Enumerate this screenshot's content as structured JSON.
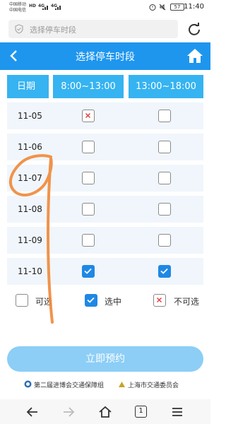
{
  "status": {
    "carrier_1": "中国移动",
    "carrier_2": "中国电信",
    "signal_1": "4G",
    "signal_2": "4G",
    "network_badge": "HD",
    "battery": "57",
    "time": "11:40"
  },
  "browser": {
    "url_placeholder": "选择停车时段",
    "shield_icon": "shield-icon",
    "reload_icon": "reload-icon"
  },
  "header": {
    "title": "选择停车时段",
    "back_icon": "chevron-left-icon",
    "home_icon": "home-icon",
    "color": "#1e96ee"
  },
  "table": {
    "columns": [
      "日期",
      "8:00~13:00",
      "13:00~18:00"
    ],
    "rows": [
      {
        "date": "11-05",
        "slot1": "unavailable",
        "slot2": "available"
      },
      {
        "date": "11-06",
        "slot1": "available",
        "slot2": "available"
      },
      {
        "date": "11-07",
        "slot1": "available",
        "slot2": "available"
      },
      {
        "date": "11-08",
        "slot1": "available",
        "slot2": "available"
      },
      {
        "date": "11-09",
        "slot1": "available",
        "slot2": "available"
      },
      {
        "date": "11-10",
        "slot1": "selected",
        "slot2": "selected"
      }
    ]
  },
  "legend": {
    "available": "可选",
    "selected": "选中",
    "unavailable": "不可选"
  },
  "actions": {
    "book_label": "立即预约"
  },
  "footer": {
    "org_1": "第二届进博会交通保障组",
    "org_2": "上海市交通委员会"
  },
  "nav": {
    "tab_count": "1",
    "icons": [
      "arrow-left-icon",
      "arrow-right-icon",
      "home-icon",
      "tabs-icon",
      "menu-icon"
    ]
  },
  "colors": {
    "accent": "#1e96ee",
    "table_header": "#36b3f1",
    "checkbox_selected": "#1e88e5",
    "button": "#8ccef6",
    "unavailable_mark": "#e53935"
  }
}
